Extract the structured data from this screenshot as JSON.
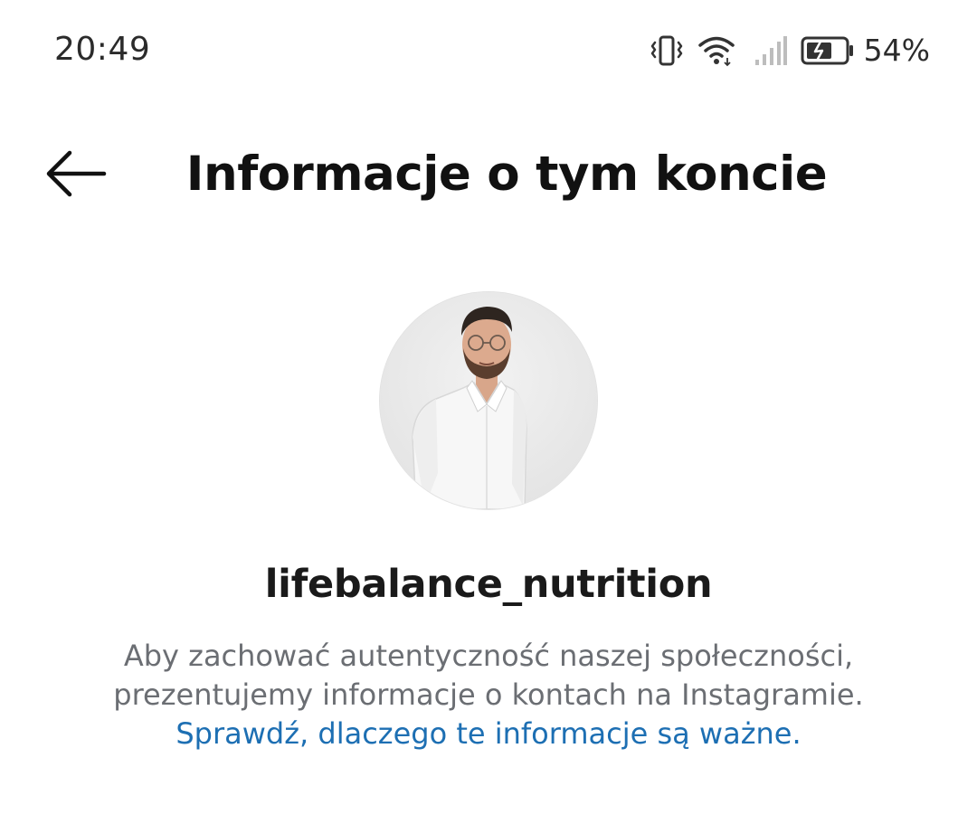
{
  "status_bar": {
    "time": "20:49",
    "icons": [
      "vibrate-icon",
      "wifi-icon",
      "signal-icon",
      "battery-saver-icon"
    ],
    "battery_percent": "54%"
  },
  "header": {
    "back_icon": "arrow-left-icon",
    "title": "Informacje o tym koncie"
  },
  "profile": {
    "avatar": "profile-photo",
    "username": "lifebalance_nutrition"
  },
  "info": {
    "line1": "Aby zachować autentyczność naszej społeczności,",
    "line2": "prezentujemy informacje o kontach na Instagramie.",
    "link_text": "Sprawdź, dlaczego te informacje są ważne."
  },
  "colors": {
    "link": "#1d6fb3",
    "secondary_text": "#6b6e73",
    "primary_text": "#111111"
  }
}
